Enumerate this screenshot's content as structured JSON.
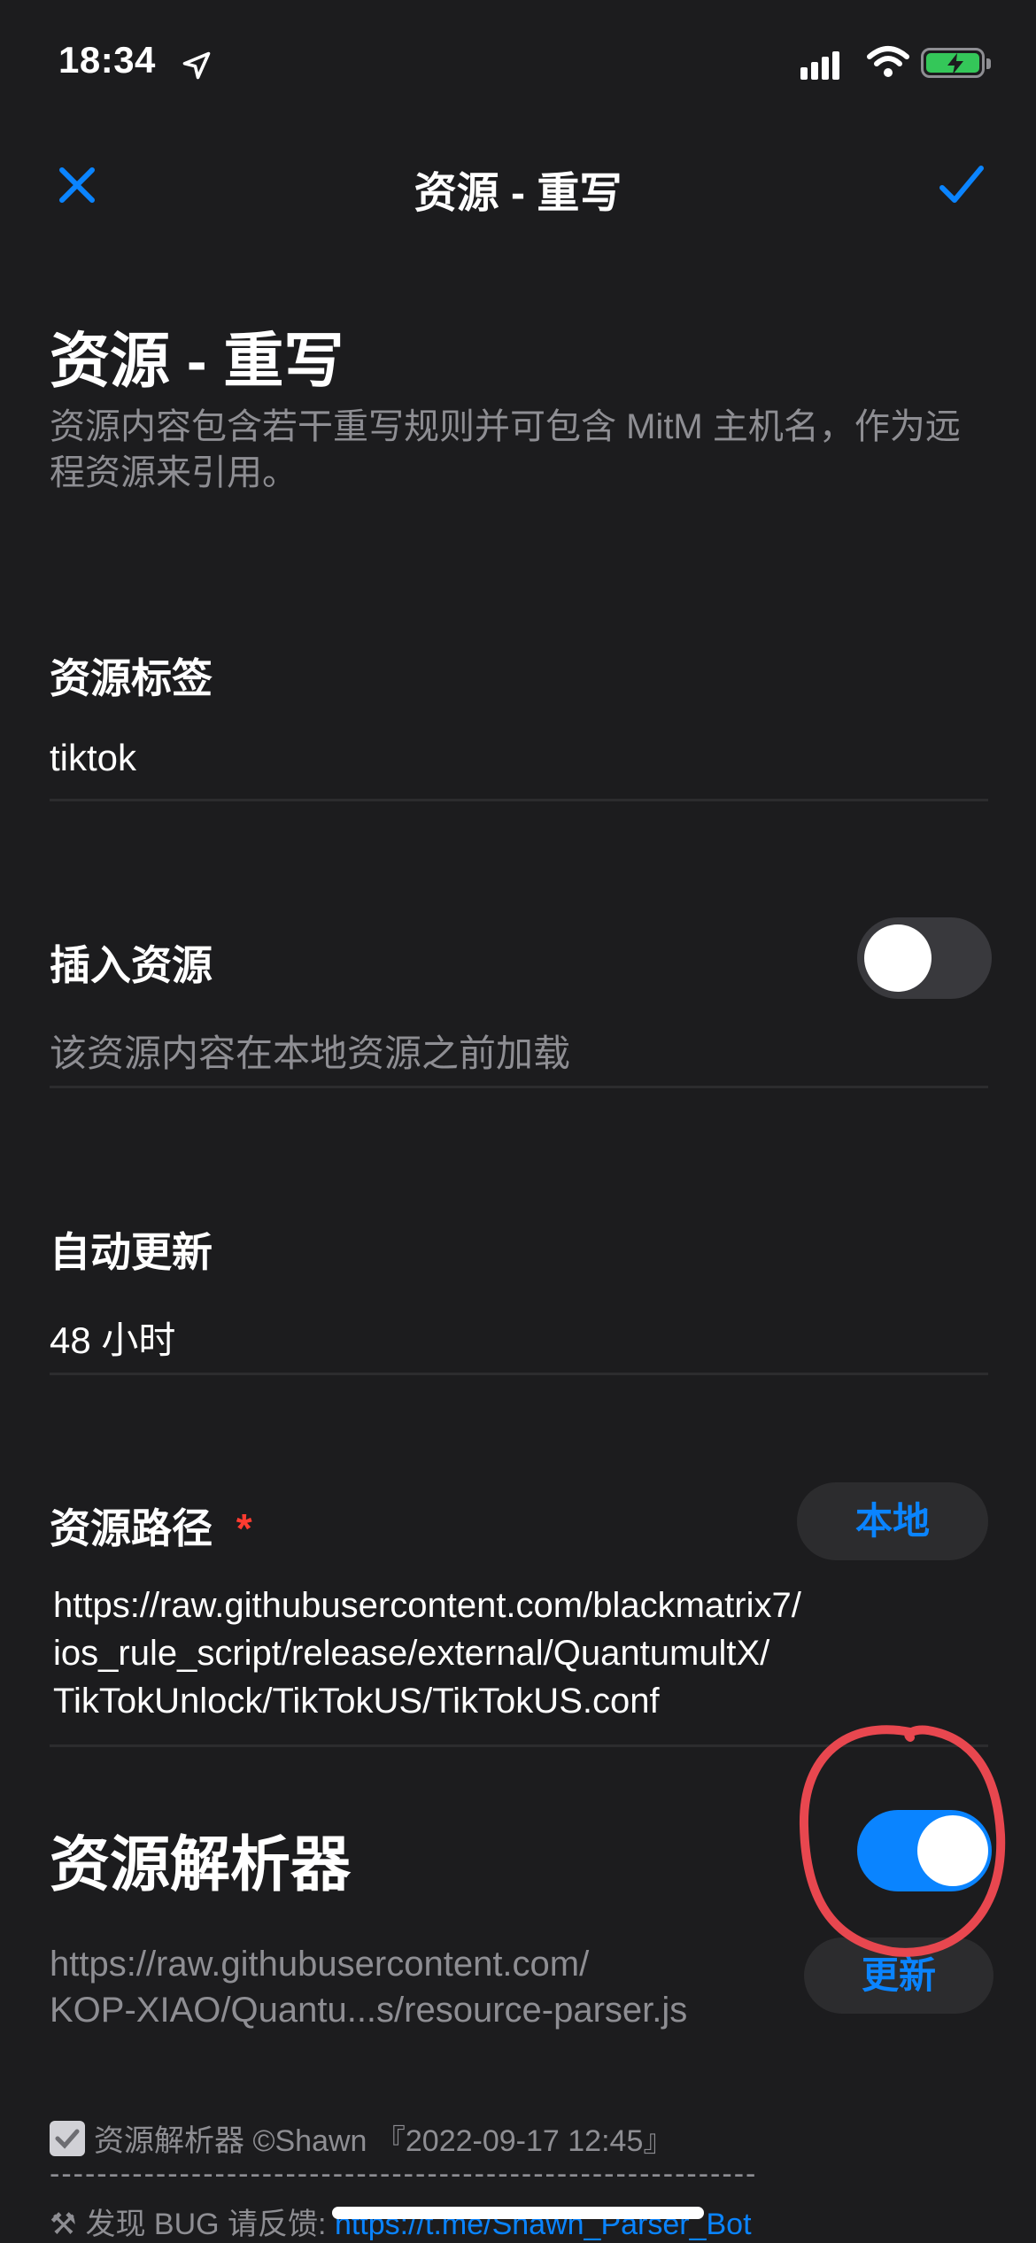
{
  "status_bar": {
    "time": "18:34"
  },
  "nav": {
    "title": "资源 - 重写"
  },
  "header": {
    "title": "资源 - 重写",
    "description": "资源内容包含若干重写规则并可包含 MitM 主机名，作为远程资源来引用。"
  },
  "resource_tag": {
    "label": "资源标签",
    "value": "tiktok"
  },
  "insert_resource": {
    "label": "插入资源",
    "hint": "该资源内容在本地资源之前加载",
    "enabled": false
  },
  "auto_update": {
    "label": "自动更新",
    "value": "48 小时"
  },
  "resource_path": {
    "label": "资源路径",
    "required_mark": "*",
    "local_button": "本地",
    "url_lines": [
      "https://raw.githubusercontent.com/blackmatrix7/",
      "ios_rule_script/release/external/QuantumultX/",
      "TikTokUnlock/TikTokUS/TikTokUS.conf"
    ]
  },
  "resource_parser": {
    "label": "资源解析器",
    "enabled": true,
    "url_lines": [
      "https://raw.githubusercontent.com/",
      "KOP-XIAO/Quantu...s/resource-parser.js"
    ],
    "update_button": "更新"
  },
  "footer": {
    "parser_info": "资源解析器 ©Shawn 『2022-09-17 12:45』",
    "dashes": "------------------------------------------------------------",
    "bug_prefix": "发现 BUG 请反馈: ",
    "bug_link": "https://t.me/Shawn_Parser_Bot"
  },
  "colors": {
    "accent": "#0a84ff",
    "background": "#1c1c1e",
    "annotation": "#e8474f"
  }
}
